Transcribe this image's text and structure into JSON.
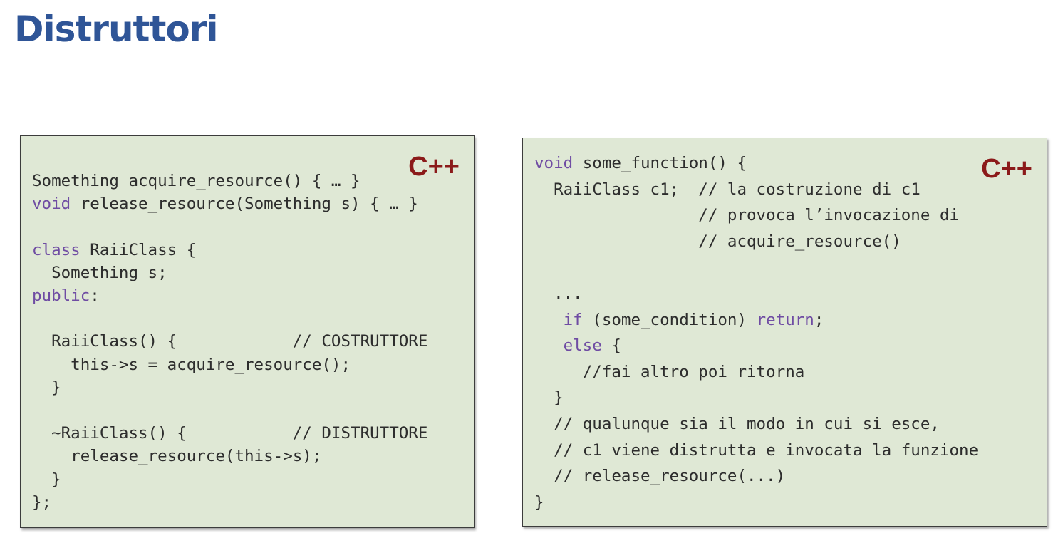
{
  "title": "Distruttori",
  "boxes": [
    {
      "language_label": "C++",
      "lines": [
        [
          {
            "t": "Something acquire_resource() { … }",
            "k": false
          }
        ],
        [
          {
            "t": "void",
            "k": true
          },
          {
            "t": " release_resource(Something s) { … }",
            "k": false
          }
        ],
        [],
        [
          {
            "t": "class",
            "k": true
          },
          {
            "t": " RaiiClass {",
            "k": false
          }
        ],
        [
          {
            "t": "  Something s;",
            "k": false
          }
        ],
        [
          {
            "t": "public",
            "k": true
          },
          {
            "t": ":",
            "k": false
          }
        ],
        [],
        [
          {
            "t": "  RaiiClass() {            // COSTRUTTORE",
            "k": false
          }
        ],
        [
          {
            "t": "    this->s = acquire_resource();",
            "k": false
          }
        ],
        [
          {
            "t": "  }",
            "k": false
          }
        ],
        [],
        [
          {
            "t": "  ~RaiiClass() {           // DISTRUTTORE",
            "k": false
          }
        ],
        [
          {
            "t": "    release_resource(this->s);",
            "k": false
          }
        ],
        [
          {
            "t": "  }",
            "k": false
          }
        ],
        [
          {
            "t": "};",
            "k": false
          }
        ]
      ]
    },
    {
      "language_label": "C++",
      "lines": [
        [
          {
            "t": "void",
            "k": true
          },
          {
            "t": " some_function() {",
            "k": false
          }
        ],
        [
          {
            "t": "  RaiiClass c1;  // la costruzione di c1",
            "k": false
          }
        ],
        [
          {
            "t": "                 // provoca l’invocazione di",
            "k": false
          }
        ],
        [
          {
            "t": "                 // acquire_resource()",
            "k": false
          }
        ],
        [],
        [
          {
            "t": "  ...",
            "k": false
          }
        ],
        [
          {
            "t": "   ",
            "k": false
          },
          {
            "t": "if",
            "k": true
          },
          {
            "t": " (some_condition) ",
            "k": false
          },
          {
            "t": "return",
            "k": true
          },
          {
            "t": ";",
            "k": false
          }
        ],
        [
          {
            "t": "   ",
            "k": false
          },
          {
            "t": "else",
            "k": true
          },
          {
            "t": " {",
            "k": false
          }
        ],
        [
          {
            "t": "     //fai altro poi ritorna",
            "k": false
          }
        ],
        [
          {
            "t": "  }",
            "k": false
          }
        ],
        [
          {
            "t": "  // qualunque sia il modo in cui si esce,",
            "k": false
          }
        ],
        [
          {
            "t": "  // c1 viene distrutta e invocata la funzione",
            "k": false
          }
        ],
        [
          {
            "t": "  // release_resource(...)",
            "k": false
          }
        ],
        [
          {
            "t": "}",
            "k": false
          }
        ]
      ]
    }
  ]
}
